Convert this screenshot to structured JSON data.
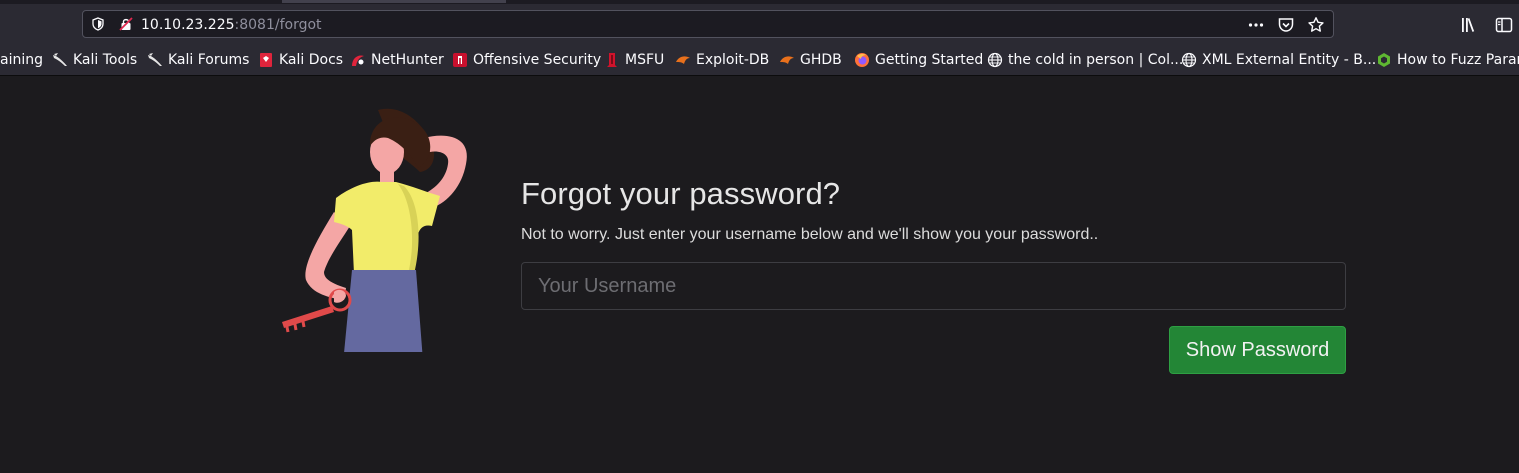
{
  "browser": {
    "url_host": "10.10.23.225",
    "url_rest": ":8081/forgot",
    "icons": {
      "shield": "tracking-protection-shield-icon",
      "lock": "insecure-lock-icon",
      "page_actions": "more-actions-icon",
      "pocket": "pocket-icon",
      "bookmark": "bookmark-star-icon",
      "library": "library-icon",
      "sidebar": "sidebar-icon"
    }
  },
  "bookmarks": [
    {
      "label": "aining",
      "icon": "none"
    },
    {
      "label": "Kali Tools",
      "icon": "kali-dragon-icon"
    },
    {
      "label": "Kali Forums",
      "icon": "kali-dragon-icon"
    },
    {
      "label": "Kali Docs",
      "icon": "kali-docs-icon"
    },
    {
      "label": "NetHunter",
      "icon": "nethunter-icon"
    },
    {
      "label": "Offensive Security",
      "icon": "offsec-icon"
    },
    {
      "label": "MSFU",
      "icon": "msfu-icon"
    },
    {
      "label": "Exploit-DB",
      "icon": "exploit-db-icon"
    },
    {
      "label": "GHDB",
      "icon": "ghdb-icon"
    },
    {
      "label": "Getting Started",
      "icon": "firefox-icon"
    },
    {
      "label": "the cold in person | Col...",
      "icon": "globe-icon"
    },
    {
      "label": "XML External Entity - B...",
      "icon": "globe-icon"
    },
    {
      "label": "How to Fuzz Param",
      "icon": "green-hex-icon"
    }
  ],
  "form": {
    "title": "Forgot your password?",
    "subtitle": "Not to worry. Just enter your username below and we'll show you your password..",
    "username_placeholder": "Your Username",
    "username_value": "",
    "submit_label": "Show Password"
  },
  "colors": {
    "page_background": "#1c1b1e",
    "button_green": "#238636",
    "chrome_toolbar": "#2b2a33"
  }
}
